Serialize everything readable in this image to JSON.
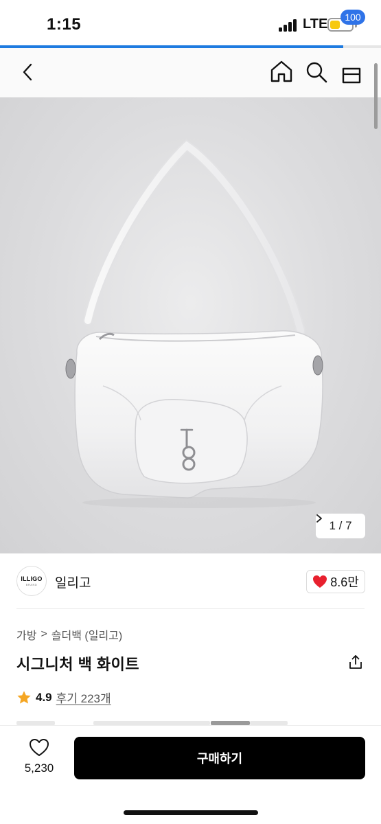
{
  "status_bar": {
    "time": "1:15",
    "network": "LTE"
  },
  "page_load_progress": 0.9,
  "nav": {
    "back_icon": "chevron-left-icon",
    "home_icon": "home-icon",
    "search_icon": "search-icon",
    "cart_icon": "cart-icon",
    "cart_badge": "100",
    "badge_color": "#2f73e8"
  },
  "image_gallery": {
    "counter": "1 / 7",
    "current": 1,
    "total": 7
  },
  "brand": {
    "logo_text": "ILLIGO",
    "logo_subtext": "BRAND",
    "name": "일리고",
    "likes": "8.6만"
  },
  "breadcrumb": {
    "category": "가방",
    "separator": ">",
    "subcategory": "숄더백 (일리고)"
  },
  "product": {
    "title": "시그니처 백 화이트"
  },
  "rating": {
    "score": "4.9",
    "reviews": "후기 223개",
    "star_color": "#f5a623"
  },
  "bottom_bar": {
    "wish_count": "5,230",
    "buy_label": "구매하기",
    "buy_color": "#000000"
  },
  "colors": {
    "heart": "#e8202e",
    "accent": "#1e7be0"
  }
}
